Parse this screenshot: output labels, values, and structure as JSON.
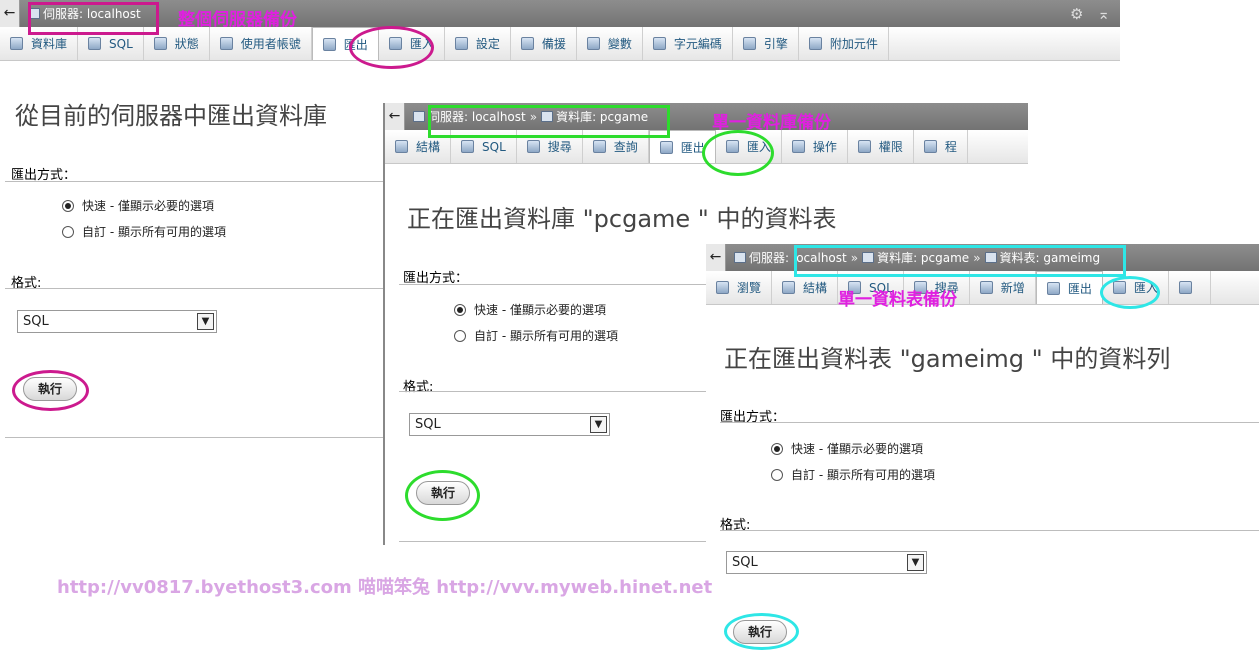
{
  "colors": {
    "magenta": "#cc1a8e",
    "green": "#2ddc2d",
    "cyan": "#2ee6e6",
    "annotation_text": "#e020e0"
  },
  "server_panel": {
    "back_label": "←",
    "breadcrumb": "伺服器: localhost",
    "tabs": [
      {
        "icon": "database-icon",
        "label": "資料庫"
      },
      {
        "icon": "sql-icon",
        "label": "SQL"
      },
      {
        "icon": "status-icon",
        "label": "狀態"
      },
      {
        "icon": "users-icon",
        "label": "使用者帳號"
      },
      {
        "icon": "export-icon",
        "label": "匯出"
      },
      {
        "icon": "import-icon",
        "label": "匯入"
      },
      {
        "icon": "settings-icon",
        "label": "設定"
      },
      {
        "icon": "replication-icon",
        "label": "備援"
      },
      {
        "icon": "variables-icon",
        "label": "變數"
      },
      {
        "icon": "charset-icon",
        "label": "字元編碼"
      },
      {
        "icon": "engines-icon",
        "label": "引擎"
      },
      {
        "icon": "plugins-icon",
        "label": "附加元件"
      }
    ],
    "title": "從目前的伺服器中匯出資料庫",
    "method_label": "匯出方式：",
    "quick_option": "快速 - 僅顯示必要的選項",
    "custom_option": "自訂 - 顯示所有可用的選項",
    "format_label": "格式:",
    "format_value": "SQL",
    "go_label": "執行"
  },
  "db_panel": {
    "back_label": "←",
    "crumb_server": "伺服器: localhost",
    "crumb_db": "資料庫: pcgame",
    "tabs": [
      {
        "icon": "structure-icon",
        "label": "結構"
      },
      {
        "icon": "sql-icon",
        "label": "SQL"
      },
      {
        "icon": "search-icon",
        "label": "搜尋"
      },
      {
        "icon": "query-icon",
        "label": "查詢"
      },
      {
        "icon": "export-icon",
        "label": "匯出"
      },
      {
        "icon": "import-icon",
        "label": "匯入"
      },
      {
        "icon": "operations-icon",
        "label": "操作"
      },
      {
        "icon": "privileges-icon",
        "label": "權限"
      },
      {
        "icon": "routines-icon",
        "label": "程"
      }
    ],
    "title": "正在匯出資料庫 \"pcgame \" 中的資料表",
    "method_label": "匯出方式：",
    "quick_option": "快速 - 僅顯示必要的選項",
    "custom_option": "自訂 - 顯示所有可用的選項",
    "format_label": "格式:",
    "format_value": "SQL",
    "go_label": "執行"
  },
  "table_panel": {
    "back_label": "←",
    "crumb_server": "伺服器: localhost",
    "crumb_db": "資料庫: pcgame",
    "crumb_table": "資料表: gameimg",
    "tabs": [
      {
        "icon": "browse-icon",
        "label": "瀏覽"
      },
      {
        "icon": "structure-icon",
        "label": "結構"
      },
      {
        "icon": "sql-icon",
        "label": "SQL"
      },
      {
        "icon": "search-icon",
        "label": "搜尋"
      },
      {
        "icon": "insert-icon",
        "label": "新增"
      },
      {
        "icon": "export-icon",
        "label": "匯出"
      },
      {
        "icon": "import-icon",
        "label": "匯入"
      },
      {
        "icon": "more-icon",
        "label": ""
      }
    ],
    "title": "正在匯出資料表 \"gameimg \" 中的資料列",
    "method_label": "匯出方式：",
    "quick_option": "快速 - 僅顯示必要的選項",
    "custom_option": "自訂 - 顯示所有可用的選項",
    "format_label": "格式:",
    "format_value": "SQL",
    "go_label": "執行"
  },
  "annotations": {
    "server_backup": "整個伺服器備份",
    "db_backup": "單一資料庫備份",
    "table_backup": "單一資料表備份"
  },
  "watermark": "http://vv0817.byethost3.com 喵喵笨兔 http://vvv.myweb.hinet.net",
  "icons": {
    "gear": "⚙",
    "collapse": "⌅",
    "select_arrow": "▼"
  }
}
